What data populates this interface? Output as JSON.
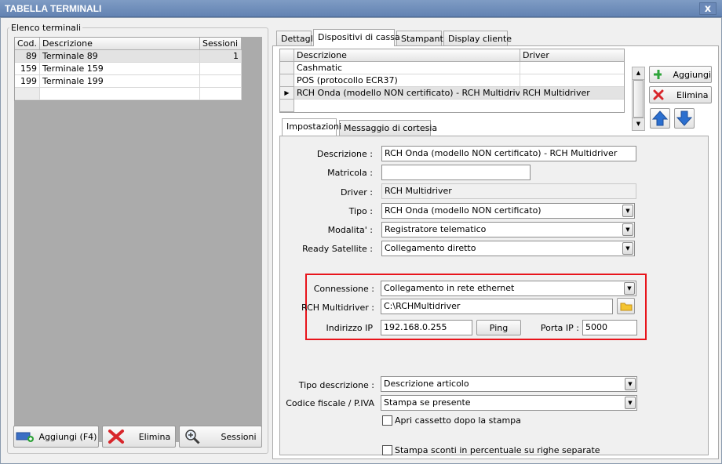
{
  "window": {
    "title": "TABELLA TERMINALI",
    "close_label": "x"
  },
  "left": {
    "group_label": "Elenco terminali",
    "columns": [
      "Cod.",
      "Descrizione",
      "Sessioni"
    ],
    "rows": [
      {
        "cod": "89",
        "desc": "Terminale 89",
        "sessioni": "1"
      },
      {
        "cod": "159",
        "desc": "Terminale 159",
        "sessioni": ""
      },
      {
        "cod": "199",
        "desc": "Terminale 199",
        "sessioni": ""
      }
    ],
    "buttons": {
      "add": "Aggiungi (F4)",
      "delete": "Elimina",
      "sessions": "Sessioni"
    }
  },
  "tabs": [
    "Dettagli",
    "Dispositivi di cassa",
    "Stampanti",
    "Display cliente"
  ],
  "devices": {
    "columns": [
      "Descrizione",
      "Driver"
    ],
    "rows": [
      {
        "desc": "Cashmatic",
        "driver": ""
      },
      {
        "desc": "POS (protocollo ECR37)",
        "driver": ""
      },
      {
        "desc": "RCH Onda (modello NON certificato) - RCH Multidriver",
        "driver": "RCH Multidriver"
      }
    ],
    "add_label": "Aggiungi",
    "delete_label": "Elimina"
  },
  "subtabs": [
    "Impostazioni",
    "Messaggio di cortesia"
  ],
  "form": {
    "descrizione": {
      "label": "Descrizione :",
      "value": "RCH Onda (modello NON certificato) - RCH Multidriver"
    },
    "matricola": {
      "label": "Matricola :",
      "value": ""
    },
    "driver": {
      "label": "Driver :",
      "value": "RCH Multidriver"
    },
    "tipo": {
      "label": "Tipo :",
      "value": "RCH Onda (modello NON certificato)"
    },
    "modalita": {
      "label": "Modalita' :",
      "value": "Registratore telematico"
    },
    "ready_satellite": {
      "label": "Ready Satellite :",
      "value": "Collegamento diretto"
    },
    "connessione": {
      "label": "Connessione :",
      "value": "Collegamento in rete ethernet"
    },
    "rch_multidriver": {
      "label": "RCH Multidriver :",
      "value": "C:\\RCHMultidriver"
    },
    "indirizzo_ip": {
      "label": "Indirizzo IP",
      "value": "192.168.0.255"
    },
    "ping_label": "Ping",
    "porta_ip": {
      "label": "Porta IP :",
      "value": "5000"
    },
    "tipo_descrizione": {
      "label": "Tipo descrizione :",
      "value": "Descrizione articolo"
    },
    "codice_fiscale": {
      "label": "Codice fiscale / P.IVA",
      "value": "Stampa se presente"
    },
    "apri_cassetto": {
      "label": "Apri cassetto dopo la stampa",
      "checked": false
    },
    "stampa_sconti": {
      "label": "Stampa sconti in percentuale su righe separate",
      "checked": false
    }
  },
  "colors": {
    "highlight_border": "#e8141b",
    "title_bar": "#6f8fbe"
  }
}
